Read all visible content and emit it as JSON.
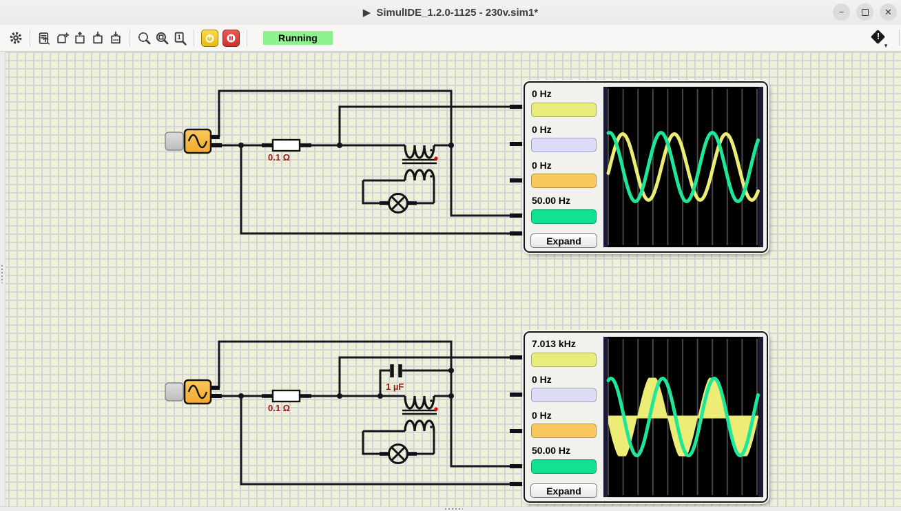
{
  "window": {
    "play_glyph": "▶",
    "title": "SimulIDE_1.2.0-1125 - 230v.sim1*",
    "controls": {
      "minimize_glyph": "−",
      "close_glyph": "✕"
    }
  },
  "toolbar": {
    "status": "Running",
    "status_bg": "#8df28d",
    "icon_names": [
      "settings-gear",
      "recent-circuits",
      "new-circuit",
      "open-circuit",
      "save-circuit",
      "save-circuit-as",
      "zoom-to-fit",
      "zoom-to-selection",
      "zoom-one-to-one",
      "power",
      "pause",
      "info"
    ]
  },
  "circuit": {
    "resistor1_label": "0.1 Ω",
    "resistor2_label": "0.1 Ω",
    "capacitor_label": "1 µF",
    "wire_color": "#16161f",
    "source_color": "#f7b63c",
    "label_color": "#8b1a1a"
  },
  "scopes": [
    {
      "channels": [
        {
          "freq": "0 Hz",
          "color": "#e9ec7a",
          "border": "#a6a85e"
        },
        {
          "freq": "0 Hz",
          "color": "#dddcf6",
          "border": "#9d9cc8"
        },
        {
          "freq": "0 Hz",
          "color": "#f8c95e",
          "border": "#bb9140"
        },
        {
          "freq": "50.00 Hz",
          "color": "#10e291",
          "border": "#0b9f66"
        }
      ],
      "expand": "Expand",
      "waves": [
        {
          "type": "sine",
          "color": "#ecec76",
          "amp": 48,
          "period": 75,
          "peak": 28,
          "width": 5
        },
        {
          "type": "sine",
          "color": "#1fe79a",
          "amp": 50,
          "period": 74.5,
          "peak": 9,
          "width": 5
        }
      ]
    },
    {
      "channels": [
        {
          "freq": "7.013 kHz",
          "color": "#e9ec7a",
          "border": "#a6a85e"
        },
        {
          "freq": "0 Hz",
          "color": "#dddcf6",
          "border": "#9d9cc8"
        },
        {
          "freq": "0 Hz",
          "color": "#f8c95e",
          "border": "#bb9140"
        },
        {
          "freq": "50.00 Hz",
          "color": "#10e291",
          "border": "#0b9f66"
        }
      ],
      "expand": "Expand",
      "waves": [
        {
          "type": "filled",
          "color": "#ecec76",
          "amp": 62,
          "clip": 57,
          "period": 88,
          "trough": 27,
          "axis_width": 4
        },
        {
          "type": "sine",
          "color": "#1fe79a",
          "amp": 56,
          "period": 75,
          "peak": 11,
          "width": 5
        }
      ]
    }
  ]
}
